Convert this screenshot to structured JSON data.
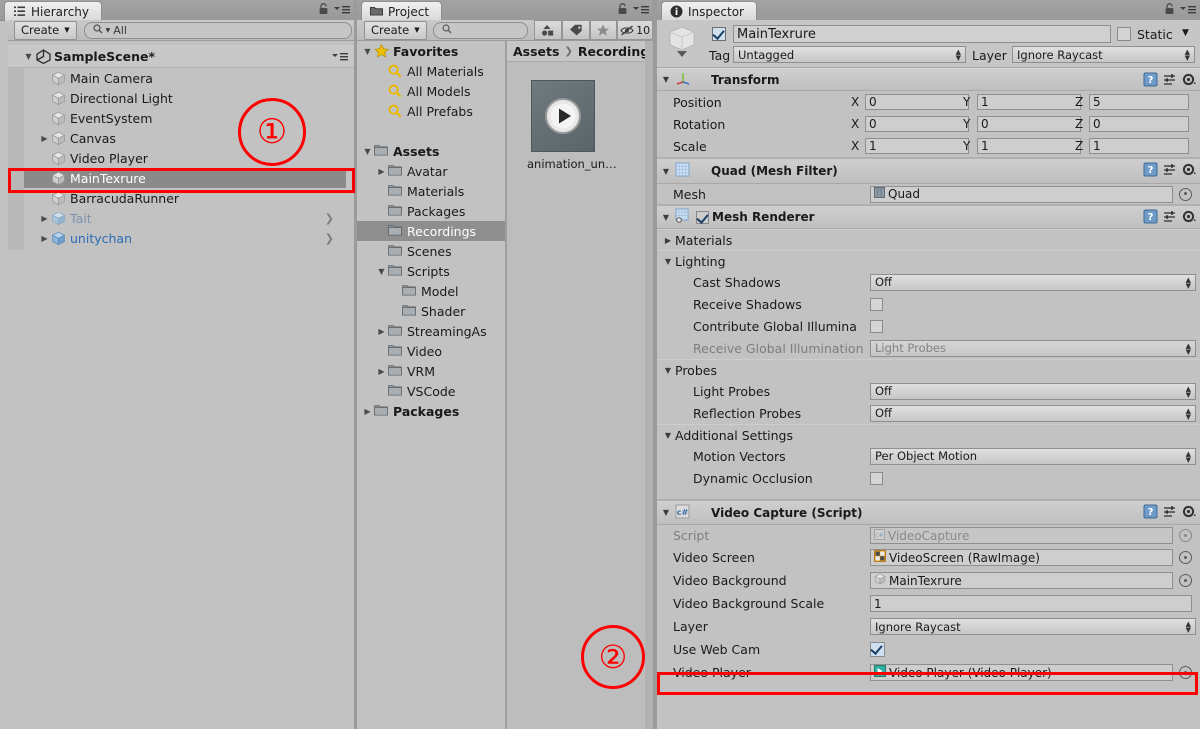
{
  "hierarchy": {
    "tab_label": "Hierarchy",
    "tab_icon": "hierarchy-icon",
    "create_label": "Create",
    "search_placeholder": "All",
    "scene_name": "SampleScene*",
    "items": [
      {
        "label": "Main Camera",
        "depth": 1,
        "arrow": false,
        "style": "normal",
        "selected": false,
        "overflow": false
      },
      {
        "label": "Directional Light",
        "depth": 1,
        "arrow": false,
        "style": "normal",
        "selected": false,
        "overflow": false
      },
      {
        "label": "EventSystem",
        "depth": 1,
        "arrow": false,
        "style": "normal",
        "selected": false,
        "overflow": false
      },
      {
        "label": "Canvas",
        "depth": 1,
        "arrow": true,
        "style": "normal",
        "selected": false,
        "overflow": false
      },
      {
        "label": "Video Player",
        "depth": 1,
        "arrow": false,
        "style": "normal",
        "selected": false,
        "overflow": false
      },
      {
        "label": "MainTexrure",
        "depth": 1,
        "arrow": false,
        "style": "normal",
        "selected": true,
        "overflow": false
      },
      {
        "label": "BarracudaRunner",
        "depth": 1,
        "arrow": false,
        "style": "normal",
        "selected": false,
        "overflow": false
      },
      {
        "label": "Tait",
        "depth": 1,
        "arrow": true,
        "style": "prefab-missing",
        "selected": false,
        "overflow": true
      },
      {
        "label": "unitychan",
        "depth": 1,
        "arrow": true,
        "style": "prefab",
        "selected": false,
        "overflow": true
      }
    ]
  },
  "project": {
    "tab_label": "Project",
    "create_label": "Create",
    "search_placeholder": "",
    "hidden_count": "10",
    "favorites_label": "Favorites",
    "favorites": [
      "All Materials",
      "All Models",
      "All Prefabs"
    ],
    "assets_label": "Assets",
    "tree": [
      {
        "label": "Avatar",
        "depth": 1,
        "arrow": "closed",
        "selected": false
      },
      {
        "label": "Materials",
        "depth": 1,
        "arrow": "none",
        "selected": false
      },
      {
        "label": "Packages",
        "depth": 1,
        "arrow": "none",
        "selected": false
      },
      {
        "label": "Recordings",
        "depth": 1,
        "arrow": "none",
        "selected": true
      },
      {
        "label": "Scenes",
        "depth": 1,
        "arrow": "none",
        "selected": false
      },
      {
        "label": "Scripts",
        "depth": 1,
        "arrow": "open",
        "selected": false
      },
      {
        "label": "Model",
        "depth": 2,
        "arrow": "none",
        "selected": false
      },
      {
        "label": "Shader",
        "depth": 2,
        "arrow": "none",
        "selected": false
      },
      {
        "label": "StreamingAs",
        "depth": 1,
        "arrow": "closed",
        "selected": false
      },
      {
        "label": "Video",
        "depth": 1,
        "arrow": "none",
        "selected": false
      },
      {
        "label": "VRM",
        "depth": 1,
        "arrow": "closed",
        "selected": false
      },
      {
        "label": "VSCode",
        "depth": 1,
        "arrow": "none",
        "selected": false
      }
    ],
    "packages_label": "Packages",
    "breadcrumb": [
      "Assets",
      "Recordings"
    ],
    "asset_item": {
      "label": "animation_un…",
      "icon": "video-clip-icon"
    }
  },
  "inspector": {
    "tab_label": "Inspector",
    "tab_icon": "info-icon",
    "object": {
      "enabled": true,
      "name": "MainTexrure",
      "static_label": "Static",
      "static_checked": false,
      "tag_label": "Tag",
      "tag_value": "Untagged",
      "layer_label": "Layer",
      "layer_value": "Ignore Raycast"
    },
    "transform": {
      "title": "Transform",
      "rows": [
        {
          "label": "Position",
          "x": "0",
          "y": "1",
          "z": "5"
        },
        {
          "label": "Rotation",
          "x": "0",
          "y": "0",
          "z": "0"
        },
        {
          "label": "Scale",
          "x": "1",
          "y": "1",
          "z": "1"
        }
      ],
      "axis_labels": [
        "X",
        "Y",
        "Z"
      ]
    },
    "mesh_filter": {
      "title": "Quad (Mesh Filter)",
      "mesh_label": "Mesh",
      "mesh_value": "Quad"
    },
    "mesh_renderer": {
      "title": "Mesh Renderer",
      "enabled": true,
      "materials_label": "Materials",
      "lighting_label": "Lighting",
      "cast_shadows_label": "Cast Shadows",
      "cast_shadows_value": "Off",
      "receive_shadows_label": "Receive Shadows",
      "receive_shadows_checked": false,
      "contribute_gi_label": "Contribute Global Illumina",
      "contribute_gi_checked": false,
      "receive_gi_label": "Receive Global Illumination",
      "receive_gi_value": "Light Probes",
      "probes_label": "Probes",
      "light_probes_label": "Light Probes",
      "light_probes_value": "Off",
      "reflection_probes_label": "Reflection Probes",
      "reflection_probes_value": "Off",
      "additional_settings_label": "Additional Settings",
      "motion_vectors_label": "Motion Vectors",
      "motion_vectors_value": "Per Object Motion",
      "dynamic_occlusion_label": "Dynamic Occlusion",
      "dynamic_occlusion_checked": false
    },
    "video_capture": {
      "title": "Video Capture (Script)",
      "script_label": "Script",
      "script_value": "VideoCapture",
      "rows": [
        {
          "label": "Video Screen",
          "type": "object",
          "value": "VideoScreen (RawImage)",
          "icon": "rawimage-icon"
        },
        {
          "label": "Video Background",
          "type": "object",
          "value": "MainTexrure",
          "icon": "gameobject-icon"
        },
        {
          "label": "Video Background Scale",
          "type": "text",
          "value": "1"
        },
        {
          "label": "Layer",
          "type": "popup",
          "value": "Ignore Raycast"
        },
        {
          "label": "Use Web Cam",
          "type": "check",
          "checked": true
        },
        {
          "label": "Video Player",
          "type": "object",
          "value": "Video Player (Video Player)",
          "icon": "videoplayer-icon"
        }
      ]
    }
  },
  "annotations": {
    "marker_1": "①",
    "marker_2": "②",
    "highlight_color": "#ff0000"
  }
}
